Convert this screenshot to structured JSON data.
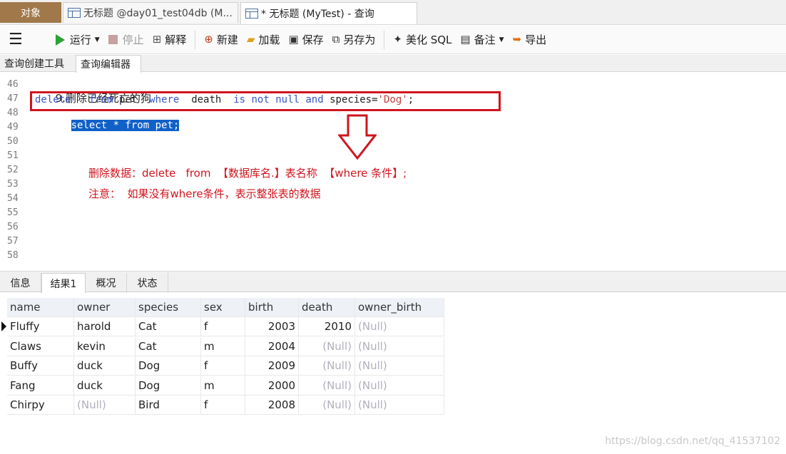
{
  "tabs": {
    "objects_label": "对象",
    "tab1_label": "无标题 @day01_test04db (M...",
    "tab2_label": "* 无标题 (MyTest) - 查询"
  },
  "toolbar": {
    "run_label": "运行",
    "stop_label": "停止",
    "explain_label": "解释",
    "new_label": "新建",
    "load_label": "加载",
    "save_label": "保存",
    "save_as_label": "另存为",
    "beautify_label": "美化 SQL",
    "note_label": "备注",
    "export_label": "导出"
  },
  "subtabs": {
    "builder_label": "查询创建工具",
    "editor_label": "查询编辑器"
  },
  "editor": {
    "line_numbers": [
      "46",
      "47",
      "48",
      "49",
      "50",
      "51",
      "52",
      "53",
      "54",
      "55",
      "56",
      "57",
      "58"
    ],
    "line46_text": "9.删除已经死亡的狗",
    "line47": {
      "kw_delete": "delete",
      "kw_from": "from",
      "table": "pet",
      "kw_where": "where",
      "column": "death",
      "kw_is_not_null": "is not null",
      "kw_and": "and",
      "column2": "species=",
      "value": "'Dog'",
      "end": ";"
    },
    "line48_text": "select * from pet;",
    "annotation_line1": "删除数据：delete   from  【数据库名.】表名称  【where 条件】;",
    "annotation_line2": "注意：  如果没有where条件，表示整张表的数据"
  },
  "bottom_tabs": [
    "信息",
    "结果1",
    "概况",
    "状态"
  ],
  "results": {
    "columns": [
      "name",
      "owner",
      "species",
      "sex",
      "birth",
      "death",
      "owner_birth"
    ],
    "rows": [
      [
        "Fluffy",
        "harold",
        "Cat",
        "f",
        "2003",
        "2010",
        "(Null)"
      ],
      [
        "Claws",
        "kevin",
        "Cat",
        "m",
        "2004",
        "(Null)",
        "(Null)"
      ],
      [
        "Buffy",
        "duck",
        "Dog",
        "f",
        "2009",
        "(Null)",
        "(Null)"
      ],
      [
        "Fang",
        "duck",
        "Dog",
        "m",
        "2000",
        "(Null)",
        "(Null)"
      ],
      [
        "Chirpy",
        "(Null)",
        "Bird",
        "f",
        "2008",
        "(Null)",
        "(Null)"
      ]
    ]
  },
  "watermark": "https://blog.csdn.net/qq_41537102",
  "colors": {
    "accent_tab": "#a0784a",
    "annotation_red": "#d0141e",
    "keyword_blue": "#3a55c8",
    "selection_blue": "#1060c8",
    "null_gray": "#b0b0bc"
  }
}
